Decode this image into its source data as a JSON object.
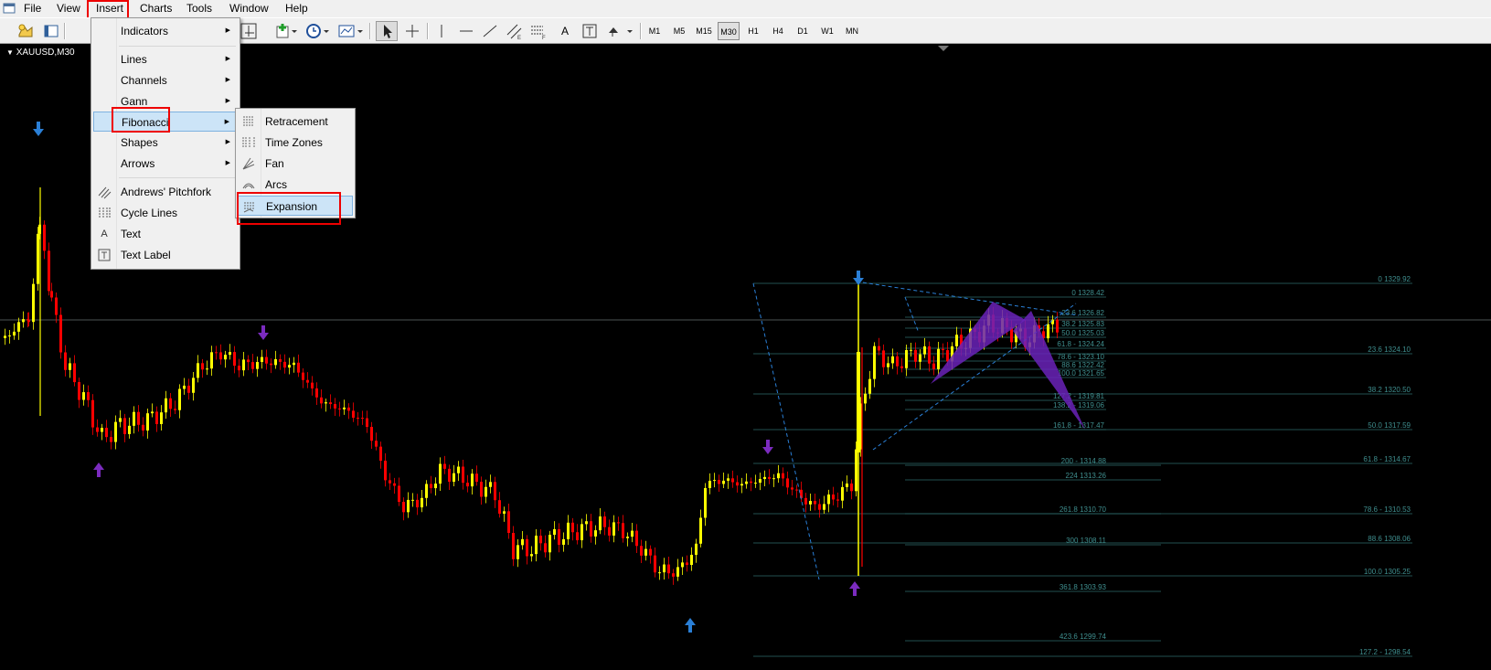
{
  "menubar": {
    "items": [
      "File",
      "View",
      "Insert",
      "Charts",
      "Tools",
      "Window",
      "Help"
    ]
  },
  "toolbar": {
    "timeframes": [
      "M1",
      "M5",
      "M15",
      "M30",
      "H1",
      "H4",
      "D1",
      "W1",
      "MN"
    ],
    "active_timeframe": "M30"
  },
  "chart": {
    "symbol_label": "XAUUSD,M30",
    "colors": {
      "bull": "#ffff00",
      "bear": "#ff0000",
      "level_line": "#2e6a6a",
      "label": "#3f8f8f",
      "pattern": "#7b2bbf"
    },
    "fib_right": [
      "0 1329.92",
      "23.6 1324.10",
      "38.2 1320.50",
      "50.0 1317.59",
      "61.8 - 1314.67",
      "78.6 - 1310.53",
      "88.6 1308.06",
      "100.0 1305.25",
      "127.2 - 1298.54"
    ],
    "fib_mid": [
      "0 1328.42",
      "23.6 1326.82",
      "38.2 1325.83",
      "50.0 1325.03",
      "61.8 - 1324.24",
      "78.6 - 1323.10",
      "88.6 1322.42",
      "100.0 1321.65",
      "127.2 - 1319.81",
      "138.2 - 1319.06",
      "161.8 - 1317.47"
    ],
    "fib_low": [
      "200 - 1314.88",
      "224 1313.26",
      "261.8 1310.70",
      "300 1308.11",
      "361.8 1303.93",
      "423.6 1299.74"
    ]
  },
  "insert_menu": {
    "items": [
      {
        "label": "Indicators",
        "submenu": true
      },
      {
        "label": "Lines",
        "submenu": true
      },
      {
        "label": "Channels",
        "submenu": true
      },
      {
        "label": "Gann",
        "submenu": true
      },
      {
        "label": "Fibonacci",
        "submenu": true
      },
      {
        "label": "Shapes",
        "submenu": true
      },
      {
        "label": "Arrows",
        "submenu": true
      },
      {
        "label": "Andrews' Pitchfork",
        "icon": "pitchfork-icon"
      },
      {
        "label": "Cycle Lines",
        "icon": "cycle-lines-icon"
      },
      {
        "label": "Text",
        "icon": "text-icon"
      },
      {
        "label": "Text Label",
        "icon": "text-label-icon"
      }
    ]
  },
  "fibonacci_submenu": {
    "items": [
      {
        "label": "Retracement",
        "icon": "fib-retracement-icon"
      },
      {
        "label": "Time Zones",
        "icon": "fib-time-zones-icon"
      },
      {
        "label": "Fan",
        "icon": "fib-fan-icon"
      },
      {
        "label": "Arcs",
        "icon": "fib-arcs-icon"
      },
      {
        "label": "Expansion",
        "icon": "fib-expansion-icon"
      }
    ]
  }
}
